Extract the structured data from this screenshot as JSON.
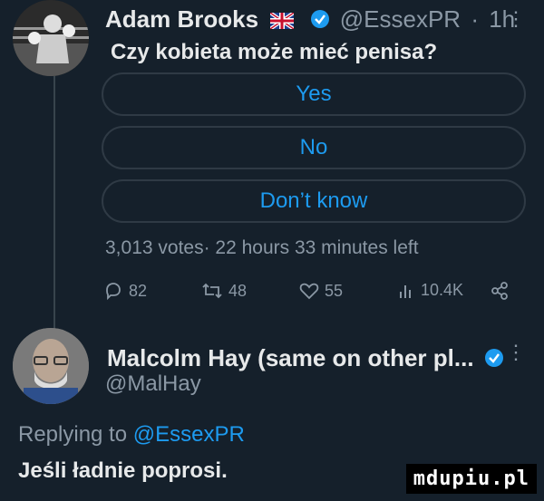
{
  "tweet1": {
    "author_name": "Adam Brooks",
    "handle": "@EssexPR",
    "time": "1h",
    "question": "Czy kobieta może mieć penisa?",
    "poll": {
      "options": [
        "Yes",
        "No",
        "Don’t know"
      ],
      "meta": "3,013 votes· 22 hours 33 minutes left"
    },
    "actions": {
      "replies": "82",
      "retweets": "48",
      "likes": "55",
      "views": "10.4K"
    }
  },
  "tweet2": {
    "author_name": "Malcolm Hay (same on other pl...",
    "handle": "@MalHay",
    "replying_prefix": "Replying to",
    "replying_to": "@EssexPR",
    "text": "Jeśli ładnie poprosi."
  },
  "watermark": "mdupiu.pl",
  "colors": {
    "background": "#15202b",
    "accent": "#1d9bf0",
    "muted": "#8b98a5"
  }
}
